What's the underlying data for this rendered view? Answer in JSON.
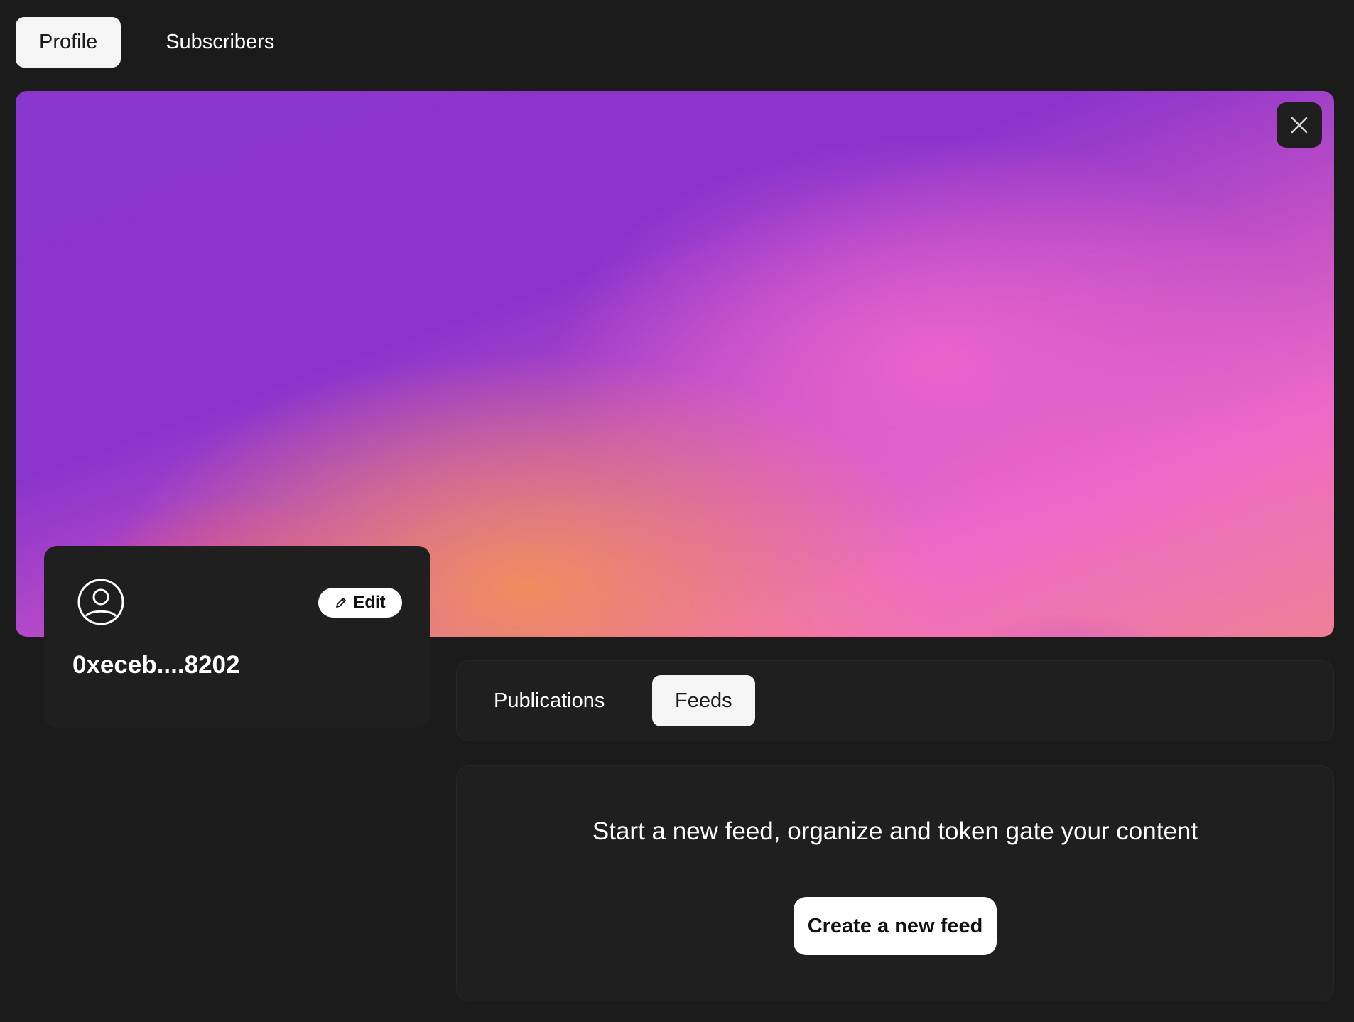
{
  "nav": {
    "tabs": [
      {
        "label": "Profile",
        "active": true
      },
      {
        "label": "Subscribers",
        "active": false
      }
    ]
  },
  "cover": {
    "close_icon": "close-icon",
    "gradient_colors": [
      "#8a35cd",
      "#ec64cd",
      "#f08e5c",
      "#e14880",
      "#c453c4"
    ]
  },
  "profile": {
    "avatar_icon": "user-circle-icon",
    "edit_label": "Edit",
    "edit_icon": "pencil-icon",
    "name": "0xeceb....8202"
  },
  "content": {
    "tabs": [
      {
        "label": "Publications",
        "active": false
      },
      {
        "label": "Feeds",
        "active": true
      }
    ],
    "empty_message": "Start a new feed, organize and token gate your content",
    "create_label": "Create a new feed"
  },
  "colors": {
    "background": "#1b1b1b",
    "card": "#1f1f1f",
    "active_tab": "#f5f5f5"
  }
}
